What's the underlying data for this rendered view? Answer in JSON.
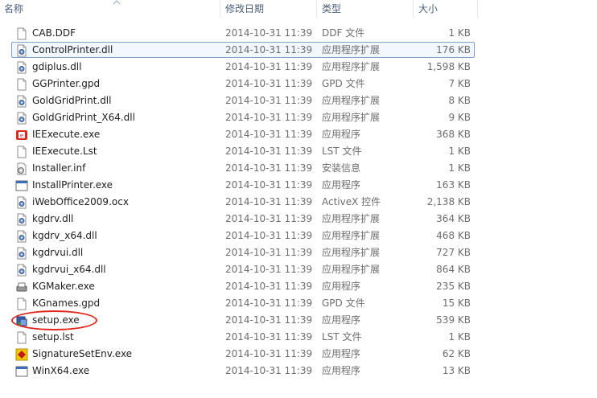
{
  "columns": {
    "name": "名称",
    "date": "修改日期",
    "type": "类型",
    "size": "大小"
  },
  "files": [
    {
      "name": "CAB.DDF",
      "date": "2014-10-31 11:39",
      "type": "DDF 文件",
      "size": "1 KB",
      "icon": "document-icon",
      "selected": false
    },
    {
      "name": "ControlPrinter.dll",
      "date": "2014-10-31 11:39",
      "type": "应用程序扩展",
      "size": "176 KB",
      "icon": "dll-gear-icon",
      "selected": true
    },
    {
      "name": "gdiplus.dll",
      "date": "2014-10-31 11:39",
      "type": "应用程序扩展",
      "size": "1,598 KB",
      "icon": "dll-gear-icon",
      "selected": false
    },
    {
      "name": "GGPrinter.gpd",
      "date": "2014-10-31 11:39",
      "type": "GPD 文件",
      "size": "7 KB",
      "icon": "document-icon",
      "selected": false
    },
    {
      "name": "GoldGridPrint.dll",
      "date": "2014-10-31 11:39",
      "type": "应用程序扩展",
      "size": "8 KB",
      "icon": "dll-gear-icon",
      "selected": false
    },
    {
      "name": "GoldGridPrint_X64.dll",
      "date": "2014-10-31 11:39",
      "type": "应用程序扩展",
      "size": "9 KB",
      "icon": "dll-gear-icon",
      "selected": false
    },
    {
      "name": "IEExecute.exe",
      "date": "2014-10-31 11:39",
      "type": "应用程序",
      "size": "368 KB",
      "icon": "red-app-icon",
      "selected": false
    },
    {
      "name": "IEExecute.Lst",
      "date": "2014-10-31 11:39",
      "type": "LST 文件",
      "size": "1 KB",
      "icon": "document-icon",
      "selected": false
    },
    {
      "name": "Installer.inf",
      "date": "2014-10-31 11:39",
      "type": "安装信息",
      "size": "1 KB",
      "icon": "inf-gear-icon",
      "selected": false
    },
    {
      "name": "InstallPrinter.exe",
      "date": "2014-10-31 11:39",
      "type": "应用程序",
      "size": "163 KB",
      "icon": "window-app-icon",
      "selected": false
    },
    {
      "name": "iWebOffice2009.ocx",
      "date": "2014-10-31 11:39",
      "type": "ActiveX 控件",
      "size": "2,138 KB",
      "icon": "dll-gear-icon",
      "selected": false
    },
    {
      "name": "kgdrv.dll",
      "date": "2014-10-31 11:39",
      "type": "应用程序扩展",
      "size": "364 KB",
      "icon": "dll-gear-icon",
      "selected": false
    },
    {
      "name": "kgdrv_x64.dll",
      "date": "2014-10-31 11:39",
      "type": "应用程序扩展",
      "size": "468 KB",
      "icon": "dll-gear-icon",
      "selected": false
    },
    {
      "name": "kgdrvui.dll",
      "date": "2014-10-31 11:39",
      "type": "应用程序扩展",
      "size": "727 KB",
      "icon": "dll-gear-icon",
      "selected": false
    },
    {
      "name": "kgdrvui_x64.dll",
      "date": "2014-10-31 11:39",
      "type": "应用程序扩展",
      "size": "864 KB",
      "icon": "dll-gear-icon",
      "selected": false
    },
    {
      "name": "KGMaker.exe",
      "date": "2014-10-31 11:39",
      "type": "应用程序",
      "size": "235 KB",
      "icon": "printer-app-icon",
      "selected": false
    },
    {
      "name": "KGnames.gpd",
      "date": "2014-10-31 11:39",
      "type": "GPD 文件",
      "size": "15 KB",
      "icon": "document-icon",
      "selected": false
    },
    {
      "name": "setup.exe",
      "date": "2014-10-31 11:39",
      "type": "应用程序",
      "size": "539 KB",
      "icon": "setup-app-icon",
      "selected": false
    },
    {
      "name": "setup.lst",
      "date": "2014-10-31 11:39",
      "type": "LST 文件",
      "size": "1 KB",
      "icon": "document-icon",
      "selected": false
    },
    {
      "name": "SignatureSetEnv.exe",
      "date": "2014-10-31 11:39",
      "type": "应用程序",
      "size": "62 KB",
      "icon": "yellow-app-icon",
      "selected": false
    },
    {
      "name": "WinX64.exe",
      "date": "2014-10-31 11:39",
      "type": "应用程序",
      "size": "13 KB",
      "icon": "window-app-icon",
      "selected": false
    }
  ],
  "highlight": {
    "color": "#e0281e",
    "target": "setup.exe"
  }
}
